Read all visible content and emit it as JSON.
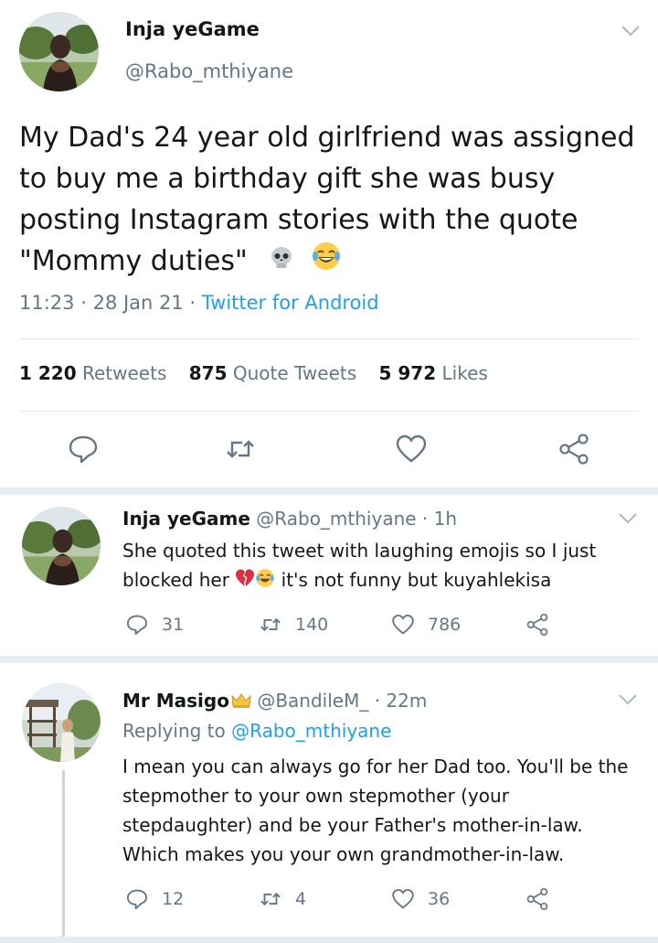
{
  "main": {
    "name": "Inja yeGame",
    "handle": "@Rabo_mthiyane",
    "text": "My Dad's 24 year old girlfriend was assigned to buy me a birthday gift she was busy posting Instagram stories with the quote \"Mommy duties\"",
    "emojis": [
      "skull",
      "joy"
    ],
    "time": "11:23",
    "date": "28 Jan 21",
    "client": "Twitter for Android",
    "retweets_count": "1 220",
    "retweets_label": "Retweets",
    "quotes_count": "875",
    "quotes_label": "Quote Tweets",
    "likes_count": "5 972",
    "likes_label": "Likes"
  },
  "replies": [
    {
      "name": "Inja yeGame",
      "handle": "@Rabo_mthiyane",
      "age": "1h",
      "text_before": "She quoted this tweet with laughing emojis so I just blocked her",
      "text_emojis": [
        "broken-heart",
        "joy"
      ],
      "text_after": "it's not funny but kuyahlekisa",
      "reply_count": "31",
      "retweet_count": "140",
      "like_count": "786"
    },
    {
      "name": "Mr Masigo",
      "name_emoji": "crown",
      "handle": "@BandileM_",
      "age": "22m",
      "replying_to_label": "Replying to",
      "replying_to_handle": "@Rabo_mthiyane",
      "text": "I mean you can always go for her Dad too. You'll be the stepmother to your own stepmother (your stepdaughter) and be your Father's mother-in-law. Which makes you your own grandmother-in-law.",
      "reply_count": "12",
      "retweet_count": "4",
      "like_count": "36"
    }
  ],
  "icons": {
    "reply": "reply-icon",
    "retweet": "retweet-icon",
    "like": "heart-icon",
    "share": "share-icon",
    "more": "chevron-down-icon"
  },
  "colors": {
    "text": "#14171a",
    "secondary": "#657786",
    "link": "#1da1f2",
    "divider": "#e1e8ed",
    "separator": "#e6ecf0"
  }
}
